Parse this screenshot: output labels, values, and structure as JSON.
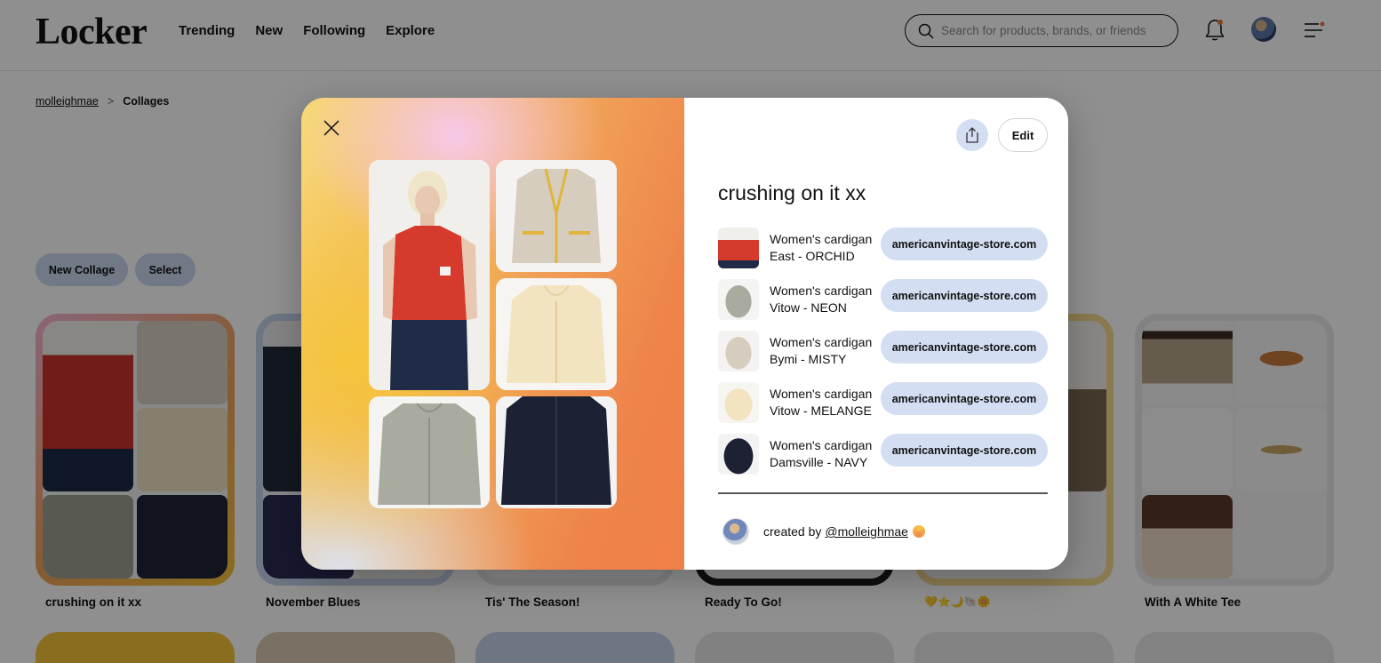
{
  "app": {
    "logo": "Locker",
    "nav": [
      "Trending",
      "New",
      "Following",
      "Explore"
    ],
    "search_placeholder": "Search for products, brands, or friends"
  },
  "icons": {
    "search": "search-icon",
    "bell": "bell-icon",
    "avatar": "user-avatar",
    "menu": "hamburger-menu-icon",
    "close": "close-icon",
    "share": "share-icon",
    "verified": "verified-badge-icon"
  },
  "breadcrumb": {
    "user": "molleighmae",
    "separator": ">",
    "current": "Collages"
  },
  "toolbar": {
    "new_collage": "New Collage",
    "select": "Select"
  },
  "collages": [
    {
      "title": "crushing on it xx",
      "frame": "#f0a25a"
    },
    {
      "title": "November Blues",
      "frame": "#c5d1ea"
    },
    {
      "title": "Tis' The Season!",
      "frame": "#e6e6e6"
    },
    {
      "title": "Ready To Go!",
      "frame": "#1a1a1a"
    },
    {
      "title": "💛⭐🌙🐚🌼",
      "frame": "#f5d98e"
    },
    {
      "title": "With A White Tee",
      "frame": "#e8e8e8"
    }
  ],
  "modal": {
    "title": "crushing on it xx",
    "edit_label": "Edit",
    "products": [
      {
        "name": "Women's cardigan East - ORCHID",
        "store": "americanvintage-store.com"
      },
      {
        "name": "Women's cardigan Vitow - NEON",
        "store": "americanvintage-store.com"
      },
      {
        "name": "Women's cardigan Bymi - MISTY",
        "store": "americanvintage-store.com"
      },
      {
        "name": "Women's cardigan Vitow - MELANGE",
        "store": "americanvintage-store.com"
      },
      {
        "name": "Women's cardigan Damsville - NAVY",
        "store": "americanvintage-store.com"
      }
    ],
    "created_by_label": "created by",
    "creator_handle": "@molleighmae"
  },
  "colors": {
    "accent_pill": "#d3def3",
    "overlay": "rgba(0,0,0,0.44)",
    "gradient_orange": "#ee844a",
    "gradient_yellow": "#f5c43a",
    "gradient_pink": "#f6c9e9"
  }
}
